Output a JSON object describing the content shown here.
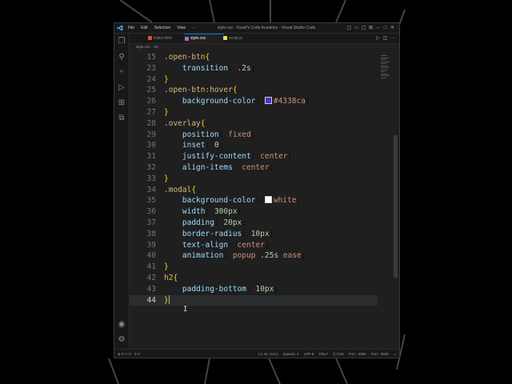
{
  "window": {
    "title": "style.css - Yousif's Code Academy - Visual Studio Code",
    "menu": [
      "File",
      "Edit",
      "Selection",
      "View",
      "···"
    ]
  },
  "titlebar_icons": [
    "layout-sidebar-icon",
    "layout-panel-icon",
    "layout-secondary-icon",
    "customize-layout-icon",
    "minimize-icon",
    "maximize-icon",
    "close-icon"
  ],
  "tabs": [
    {
      "label": "index.html",
      "color": "#e44d26",
      "active": false
    },
    {
      "label": "style.css",
      "color": "#a074c4",
      "active": true
    },
    {
      "label": "script.js",
      "color": "#f1e05a",
      "active": false
    }
  ],
  "breadcrumb": {
    "file": "style.css",
    "symbol": "h2"
  },
  "code": {
    "lines": [
      {
        "n": "15",
        "tokens": [
          [
            "sel",
            ".open-btn"
          ],
          [
            "br",
            "{"
          ]
        ]
      },
      {
        "n": "23",
        "tokens": [
          [
            "sp",
            "    "
          ],
          [
            "prop",
            "transition"
          ],
          [
            "txt",
            ": "
          ],
          [
            "num",
            ".2s"
          ],
          [
            "txt",
            ";"
          ]
        ]
      },
      {
        "n": "24",
        "tokens": [
          [
            "br",
            "}"
          ]
        ]
      },
      {
        "n": "25",
        "tokens": [
          [
            "sel",
            ".open-btn"
          ],
          [
            "pseudo",
            ":hover"
          ],
          [
            "br",
            "{"
          ]
        ]
      },
      {
        "n": "26",
        "tokens": [
          [
            "sp",
            "    "
          ],
          [
            "prop",
            "background-color"
          ],
          [
            "txt",
            ": "
          ],
          [
            "swatch",
            "#4338ca"
          ],
          [
            "val",
            "#4338ca"
          ],
          [
            "txt",
            ";"
          ]
        ]
      },
      {
        "n": "27",
        "tokens": [
          [
            "br",
            "}"
          ]
        ]
      },
      {
        "n": "28",
        "tokens": [
          [
            "sel",
            ".overlay"
          ],
          [
            "br",
            "{"
          ]
        ]
      },
      {
        "n": "29",
        "tokens": [
          [
            "sp",
            "    "
          ],
          [
            "prop",
            "position"
          ],
          [
            "txt",
            ": "
          ],
          [
            "val",
            "fixed"
          ],
          [
            "txt",
            ";"
          ]
        ]
      },
      {
        "n": "30",
        "tokens": [
          [
            "sp",
            "    "
          ],
          [
            "prop",
            "inset"
          ],
          [
            "txt",
            ": "
          ],
          [
            "num",
            "0"
          ],
          [
            "txt",
            ";"
          ]
        ]
      },
      {
        "n": "31",
        "tokens": [
          [
            "sp",
            "    "
          ],
          [
            "prop",
            "justify-content"
          ],
          [
            "txt",
            ": "
          ],
          [
            "val",
            "center"
          ],
          [
            "txt",
            ";"
          ]
        ]
      },
      {
        "n": "32",
        "tokens": [
          [
            "sp",
            "    "
          ],
          [
            "prop",
            "align-items"
          ],
          [
            "txt",
            ": "
          ],
          [
            "val",
            "center"
          ],
          [
            "txt",
            ";"
          ]
        ]
      },
      {
        "n": "33",
        "tokens": [
          [
            "br",
            "}"
          ]
        ]
      },
      {
        "n": "34",
        "tokens": [
          [
            "sel",
            ".modal"
          ],
          [
            "br",
            "{"
          ]
        ]
      },
      {
        "n": "35",
        "tokens": [
          [
            "sp",
            "    "
          ],
          [
            "prop",
            "background-color"
          ],
          [
            "txt",
            ": "
          ],
          [
            "swatch",
            "#ffffff"
          ],
          [
            "val",
            "white"
          ],
          [
            "txt",
            ";"
          ]
        ]
      },
      {
        "n": "36",
        "tokens": [
          [
            "sp",
            "    "
          ],
          [
            "prop",
            "width"
          ],
          [
            "txt",
            ": "
          ],
          [
            "num",
            "300px"
          ],
          [
            "txt",
            ";"
          ]
        ]
      },
      {
        "n": "37",
        "tokens": [
          [
            "sp",
            "    "
          ],
          [
            "prop",
            "padding"
          ],
          [
            "txt",
            ": "
          ],
          [
            "num",
            "20px"
          ],
          [
            "txt",
            ";"
          ]
        ]
      },
      {
        "n": "38",
        "tokens": [
          [
            "sp",
            "    "
          ],
          [
            "prop",
            "border-radius"
          ],
          [
            "txt",
            ": "
          ],
          [
            "num",
            "10px"
          ],
          [
            "txt",
            ";"
          ]
        ]
      },
      {
        "n": "39",
        "tokens": [
          [
            "sp",
            "    "
          ],
          [
            "prop",
            "text-align"
          ],
          [
            "txt",
            ": "
          ],
          [
            "val",
            "center"
          ],
          [
            "txt",
            ";"
          ]
        ]
      },
      {
        "n": "40",
        "tokens": [
          [
            "sp",
            "    "
          ],
          [
            "prop",
            "animation"
          ],
          [
            "txt",
            ": "
          ],
          [
            "val",
            "popup "
          ],
          [
            "num",
            ".25s"
          ],
          [
            "val",
            " ease"
          ],
          [
            "txt",
            ";"
          ]
        ]
      },
      {
        "n": "41",
        "tokens": [
          [
            "br",
            "}"
          ]
        ]
      },
      {
        "n": "42",
        "tokens": [
          [
            "tag",
            "h2"
          ],
          [
            "br",
            "{"
          ]
        ]
      },
      {
        "n": "43",
        "tokens": [
          [
            "sp",
            "    "
          ],
          [
            "prop",
            "padding-bottom"
          ],
          [
            "txt",
            ": "
          ],
          [
            "num",
            "10px"
          ],
          [
            "txt",
            ";"
          ]
        ]
      },
      {
        "n": "44",
        "tokens": [
          [
            "br",
            "}"
          ]
        ],
        "current": true
      }
    ]
  },
  "statusbar": {
    "left": [
      "⊗ 0 ⚠ 0",
      "⚲ 0"
    ],
    "right": [
      "Ln 44, Col 2",
      "Spaces: 4",
      "UTF-8",
      "CRLF",
      "{} CSS",
      "Port : 3000",
      "Port : 5500"
    ]
  },
  "colors": {
    "accent": "#0078d4",
    "background": "#1f1f1f"
  }
}
